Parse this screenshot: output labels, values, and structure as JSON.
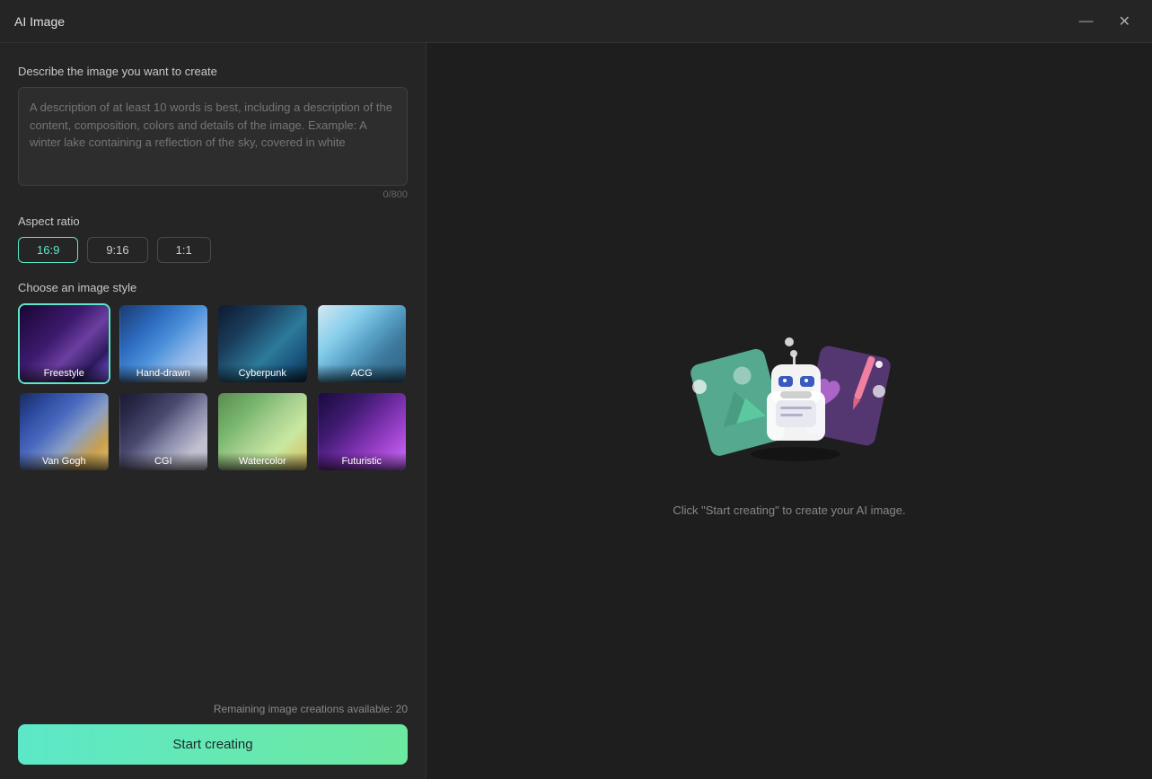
{
  "titleBar": {
    "title": "AI Image",
    "minimizeLabel": "—",
    "closeLabel": "✕"
  },
  "leftPanel": {
    "descriptionLabel": "Describe the image you want to create",
    "descriptionPlaceholder": "A description of at least 10 words is best, including a description of the content, composition, colors and details of the image. Example: A winter lake containing a reflection of the sky, covered in white",
    "charCount": "0/800",
    "aspectRatioLabel": "Aspect ratio",
    "aspectOptions": [
      {
        "id": "16:9",
        "label": "16:9",
        "active": true
      },
      {
        "id": "9:16",
        "label": "9:16",
        "active": false
      },
      {
        "id": "1:1",
        "label": "1:1",
        "active": false
      }
    ],
    "styleLabel": "Choose an image style",
    "styles": [
      {
        "id": "freestyle",
        "label": "Freestyle",
        "selected": true,
        "bgClass": "bg-freestyle"
      },
      {
        "id": "hand-drawn",
        "label": "Hand-drawn",
        "selected": false,
        "bgClass": "bg-handdrawn"
      },
      {
        "id": "cyberpunk",
        "label": "Cyberpunk",
        "selected": false,
        "bgClass": "bg-cyberpunk"
      },
      {
        "id": "acg",
        "label": "ACG",
        "selected": false,
        "bgClass": "bg-acg"
      },
      {
        "id": "van-gogh",
        "label": "Van Gogh",
        "selected": false,
        "bgClass": "bg-vangogh"
      },
      {
        "id": "cgi",
        "label": "CGI",
        "selected": false,
        "bgClass": "bg-cgi"
      },
      {
        "id": "watercolor",
        "label": "Watercolor",
        "selected": false,
        "bgClass": "bg-watercolor"
      },
      {
        "id": "futuristic",
        "label": "Futuristic",
        "selected": false,
        "bgClass": "bg-futuristic"
      }
    ],
    "remainingText": "Remaining image creations available: 20",
    "startButtonLabel": "Start creating"
  },
  "rightPanel": {
    "hintText": "Click \"Start creating\" to create your AI image."
  }
}
